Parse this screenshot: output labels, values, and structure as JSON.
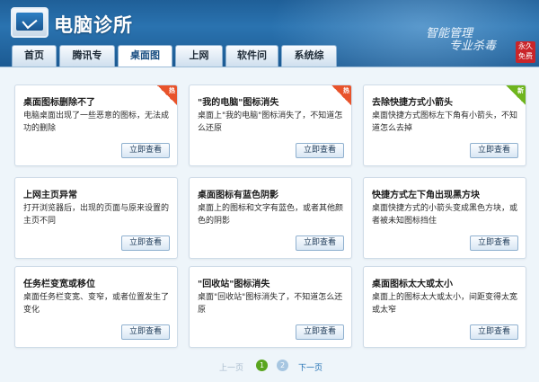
{
  "app": {
    "title": "电脑诊所",
    "slogan_line1": "智能管理",
    "slogan_line2": "专业杀毒",
    "seal_line1": "永久",
    "seal_line2": "免费"
  },
  "tabs": [
    {
      "label": "首页"
    },
    {
      "label": "腾讯专区"
    },
    {
      "label": "桌面图标",
      "active": true
    },
    {
      "label": "上网异常"
    },
    {
      "label": "软件问题"
    },
    {
      "label": "系统综合"
    }
  ],
  "cards": [
    {
      "title": "桌面图标删除不了",
      "desc": "电脑桌面出现了一些恶意的图标，无法成功的删除",
      "button": "立即查看",
      "badge": "red",
      "badge_text": "热"
    },
    {
      "title": "\"我的电脑\"图标消失",
      "desc": "桌面上\"我的电脑\"图标消失了，不知道怎么还原",
      "button": "立即查看",
      "badge": "red",
      "badge_text": "热"
    },
    {
      "title": "去除快捷方式小箭头",
      "desc": "桌面快捷方式图标左下角有小箭头，不知道怎么去掉",
      "button": "立即查看",
      "badge": "green",
      "badge_text": "新"
    },
    {
      "title": "上网主页异常",
      "desc": "打开浏览器后，出现的页面与原来设置的主页不同",
      "button": "立即查看"
    },
    {
      "title": "桌面图标有蓝色阴影",
      "desc": "桌面上的图标和文字有蓝色，或者其他颜色的阴影",
      "button": "立即查看"
    },
    {
      "title": "快捷方式左下角出现黑方块",
      "desc": "桌面快捷方式的小箭头变成黑色方块，或者被未知图标挡住",
      "button": "立即查看"
    },
    {
      "title": "任务栏变宽或移位",
      "desc": "桌面任务栏变宽、变窄，或者位置发生了变化",
      "button": "立即查看"
    },
    {
      "title": "\"回收站\"图标消失",
      "desc": "桌面\"回收站\"图标消失了，不知道怎么还原",
      "button": "立即查看"
    },
    {
      "title": "桌面图标太大或太小",
      "desc": "桌面上的图标太大或太小，间距变得太宽或太窄",
      "button": "立即查看"
    }
  ],
  "pager": {
    "prev": "上一页",
    "page1": "1",
    "page2": "2",
    "next": "下一页",
    "current": 1
  },
  "colors": {
    "header": "#2a73b0",
    "hot_badge": "#e8532b",
    "new_badge": "#6fb51e",
    "active_page": "#59a51f"
  }
}
